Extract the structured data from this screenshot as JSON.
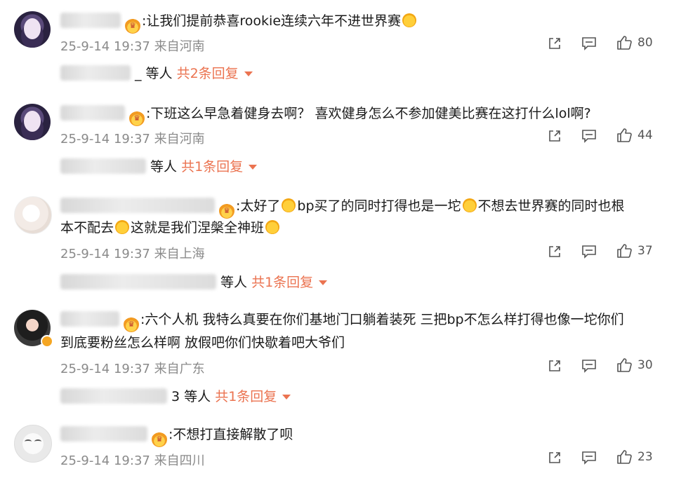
{
  "comments": [
    {
      "text_parts": [
        ":让我们提前恭喜rookie连续六年不进世界赛"
      ],
      "time": "25-9-14 19:37",
      "location": "来自河南",
      "likes": "80",
      "reply": {
        "suffix": "_ 等人",
        "count_text": "共2条回复"
      }
    },
    {
      "text_parts": [
        ":下班这么早急着健身去啊？ 喜欢健身怎么不参加健美比赛在这打什么lol啊?"
      ],
      "time": "25-9-14 19:37",
      "location": "来自河南",
      "likes": "44",
      "reply": {
        "suffix": "等人",
        "count_text": "共1条回复"
      }
    },
    {
      "text_parts": [
        ":太好了",
        "bp买了的同时打得也是一坨",
        "不想去世界赛的同时也根",
        "本不配去",
        "这就是我们涅槃全神班"
      ],
      "time": "25-9-14 19:37",
      "location": "来自上海",
      "likes": "37",
      "reply": {
        "suffix": "等人",
        "count_text": "共1条回复"
      }
    },
    {
      "text_line1": ":六个人机 我特么真要在你们基地门口躺着装死 三把bp不怎么样打得也像一坨你们",
      "text_line2": "到底要粉丝怎么样啊 放假吧你们快歇着吧大爷们",
      "time": "25-9-14 19:37",
      "location": "来自广东",
      "likes": "30",
      "reply": {
        "suffix": "3 等人",
        "count_text": "共1条回复"
      }
    },
    {
      "text_parts": [
        ":不想打直接解散了呗"
      ],
      "time": "25-9-14 19:37",
      "location": "来自四川",
      "likes": "23"
    }
  ],
  "colors": {
    "accent": "#eb7350",
    "meta": "#8a8a8a"
  },
  "icons": [
    "share-icon",
    "comment-icon",
    "like-icon",
    "crown-badge-icon",
    "emoji-icon"
  ]
}
